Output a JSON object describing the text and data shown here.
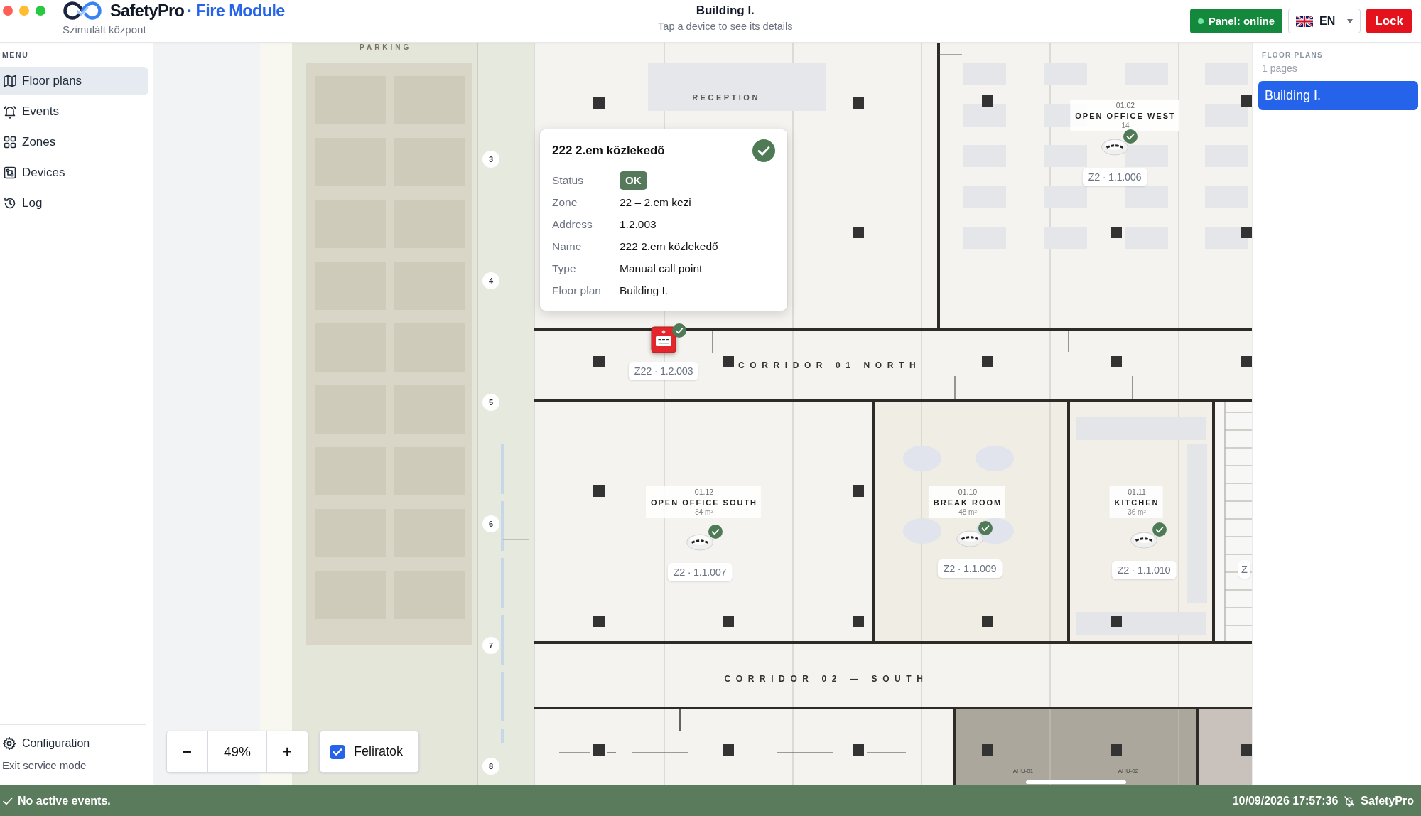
{
  "header": {
    "brand": "SafetyPro",
    "separator": "·",
    "module": "Fire Module",
    "subtitle": "Szimulált központ",
    "title": "Building I.",
    "hint": "Tap a device to see its details",
    "panel": {
      "label": "Panel: online",
      "online": true
    },
    "language": {
      "code": "EN"
    },
    "lock": "Lock"
  },
  "sidebar": {
    "heading": "MENU",
    "items": [
      {
        "label": "Floor plans",
        "selected": true
      },
      {
        "label": "Events",
        "selected": false
      },
      {
        "label": "Zones",
        "selected": false
      },
      {
        "label": "Devices",
        "selected": false
      },
      {
        "label": "Log",
        "selected": false
      }
    ],
    "configuration": "Configuration",
    "exit": "Exit service mode"
  },
  "map": {
    "parking_label": "PARKING",
    "axis_markers": [
      "3",
      "4",
      "5",
      "6",
      "7",
      "8"
    ],
    "reception": "RECEPTION",
    "rooms": [
      {
        "number": "01.02",
        "name": "OPEN OFFICE WEST",
        "area": "14"
      },
      {
        "number": "01.12",
        "name": "OPEN OFFICE SOUTH",
        "area": "84 m²"
      },
      {
        "number": "01.10",
        "name": "BREAK ROOM",
        "area": "48 m²"
      },
      {
        "number": "01.11",
        "name": "KITCHEN",
        "area": "36 m²"
      }
    ],
    "corridors": [
      "CORRIDOR 01 NORTH",
      "CORRIDOR 02 — SOUTH"
    ],
    "plant_labels": [
      "AHU-01",
      "AHU-02"
    ],
    "devices": [
      {
        "kind": "manual-call-point",
        "tag": "Z22 · 1.2.003",
        "ok": true,
        "selected": true
      },
      {
        "kind": "smoke-detector",
        "tag": "Z2 · 1.1.006",
        "ok": true,
        "selected": false
      },
      {
        "kind": "smoke-detector",
        "tag": "Z2 · 1.1.007",
        "ok": true,
        "selected": false
      },
      {
        "kind": "smoke-detector",
        "tag": "Z2 · 1.1.009",
        "ok": true,
        "selected": false
      },
      {
        "kind": "smoke-detector",
        "tag": "Z2 · 1.1.010",
        "ok": true,
        "selected": false
      }
    ],
    "cut_tag": "Z",
    "details": {
      "title": "222 2.em közlekedő",
      "ok": true,
      "fields": [
        {
          "label": "Status",
          "value": "OK",
          "kind": "badge"
        },
        {
          "label": "Zone",
          "value": "22 – 2.em kezi",
          "kind": "text"
        },
        {
          "label": "Address",
          "value": "1.2.003",
          "kind": "text"
        },
        {
          "label": "Name",
          "value": "222 2.em közlekedő",
          "kind": "text"
        },
        {
          "label": "Type",
          "value": "Manual call point",
          "kind": "text"
        },
        {
          "label": "Floor plan",
          "value": "Building I.",
          "kind": "text"
        }
      ]
    }
  },
  "zoom": {
    "decrease": "−",
    "value": "49%",
    "increase": "+"
  },
  "labels_toggle": {
    "label": "Feliratok",
    "checked": true
  },
  "floor_plans": {
    "heading": "FLOOR PLANS",
    "count": "1 pages",
    "items": [
      {
        "label": "Building I.",
        "selected": true
      }
    ]
  },
  "status_bar": {
    "active_events": false,
    "message": "No active events.",
    "datetime": "10/09/2026 17:57:36",
    "brand": "SafetyPro"
  }
}
